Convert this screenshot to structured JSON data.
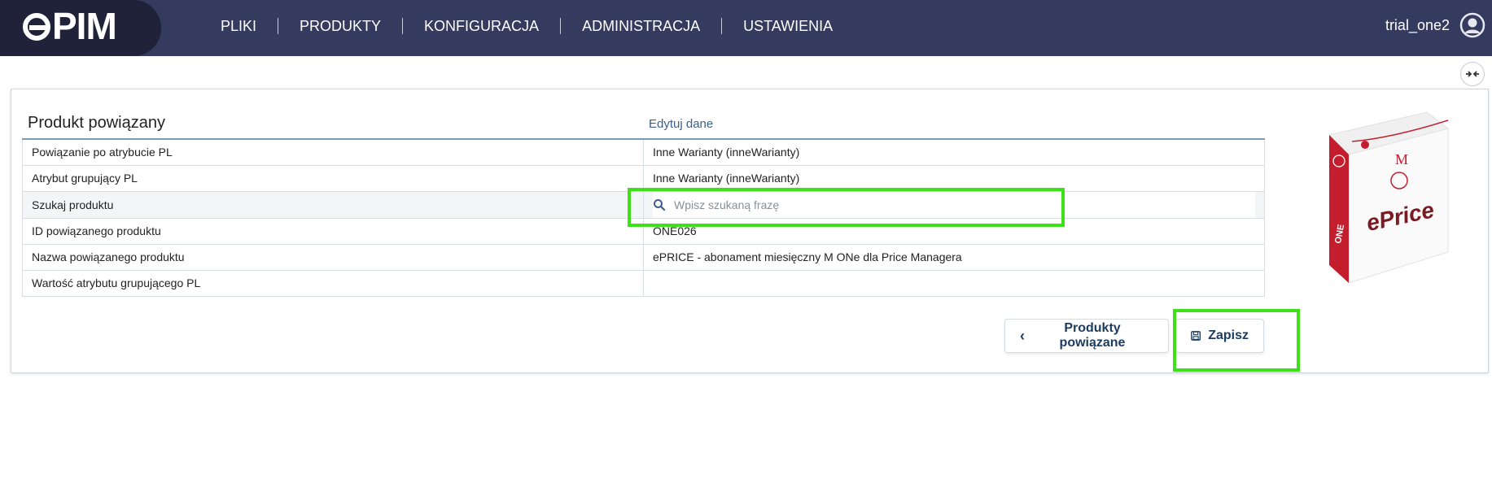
{
  "app": {
    "logo_text": "PIM"
  },
  "nav": {
    "items": [
      "PLIKI",
      "PRODUKTY",
      "KONFIGURACJA",
      "ADMINISTRACJA",
      "USTAWIENIA"
    ]
  },
  "user": {
    "name": "trial_one2",
    "avatar_icon": "user-circle-icon"
  },
  "card": {
    "title": "Produkt powiązany",
    "edit_link": "Edytuj dane",
    "rows": [
      {
        "key": "Powiązanie po atrybucie PL",
        "value": "Inne Warianty (inneWarianty)"
      },
      {
        "key": "Atrybut grupujący PL",
        "value": "Inne Warianty (inneWarianty)"
      },
      {
        "key": "Szukaj produktu",
        "search_placeholder": "Wpisz szukaną frazę"
      },
      {
        "key": "ID powiązanego produktu",
        "value": "ONE026"
      },
      {
        "key": "Nazwa powiązanego produktu",
        "value": "ePRICE - abonament miesięczny M ONe dla Price Managera"
      },
      {
        "key": "Wartość atrybutu grupującego PL",
        "value": ""
      }
    ],
    "product_image": {
      "brand": "ePrice",
      "variant": "M",
      "side_text": "ONE"
    }
  },
  "buttons": {
    "back_label": "Produkty powiązane",
    "save_label": "Zapisz"
  },
  "colors": {
    "topbar": "#353a5f",
    "logo_block": "#1f2238",
    "highlight": "#3ee019",
    "accent": "#c41e2e",
    "button_text": "#1d3c62"
  }
}
